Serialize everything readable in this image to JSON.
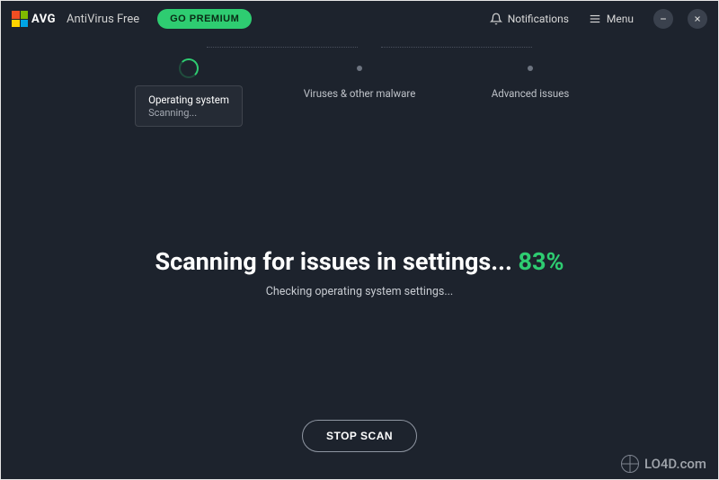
{
  "brand": {
    "logo_text": "AVG",
    "product": "AntiVirus Free"
  },
  "header": {
    "premium_label": "GO PREMIUM",
    "notifications_label": "Notifications",
    "menu_label": "Menu"
  },
  "steps": {
    "items": [
      {
        "label": "Operating system",
        "sub": "Scanning...",
        "state": "active"
      },
      {
        "label": "Viruses & other malware",
        "state": "pending"
      },
      {
        "label": "Advanced issues",
        "state": "pending"
      }
    ]
  },
  "scan": {
    "headline_prefix": "Scanning for issues in settings... ",
    "percent_text": "83%",
    "subline": "Checking operating system settings..."
  },
  "actions": {
    "stop_label": "STOP SCAN"
  },
  "watermark": {
    "text": "LO4D.com"
  }
}
